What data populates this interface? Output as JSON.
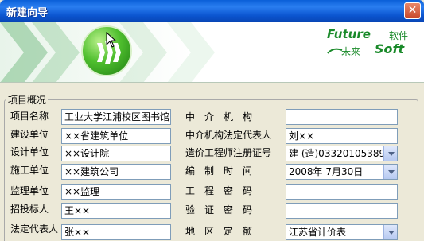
{
  "window": {
    "title": "新建向导",
    "close_glyph": "✕"
  },
  "brand": {
    "en_top": "Future",
    "cn_top": "软件",
    "cn_bottom": "未来",
    "en_bottom": "Soft",
    "color": "#1a8a2a"
  },
  "group": {
    "label": "项目概况"
  },
  "left_fields": [
    {
      "label": "项目名称",
      "value": "工业大学江浦校区图书馆"
    },
    {
      "label": "建设单位",
      "value": "××省建筑单位"
    },
    {
      "label": "设计单位",
      "value": "××设计院"
    },
    {
      "label": "施工单位",
      "value": "××建筑公司"
    },
    {
      "label": "监理单位",
      "value": "××监理"
    },
    {
      "label": "招投标人",
      "value": "王××"
    },
    {
      "label": "法定代表人",
      "value": "张××"
    }
  ],
  "right_fields": [
    {
      "label": "中　介　机　构",
      "value": ""
    },
    {
      "label": "中介机构法定代表人",
      "value": "刘××"
    },
    {
      "label": "造价工程师注册证号",
      "value": "建 (造)03320105389"
    },
    {
      "label": "编　制　时　间",
      "value": "2008年  7月30日"
    },
    {
      "label": "工　程　密　码",
      "value": ""
    },
    {
      "label": "验　证　密　码",
      "value": ""
    },
    {
      "label": "地　区　定　额",
      "value": "江苏省计价表"
    }
  ]
}
